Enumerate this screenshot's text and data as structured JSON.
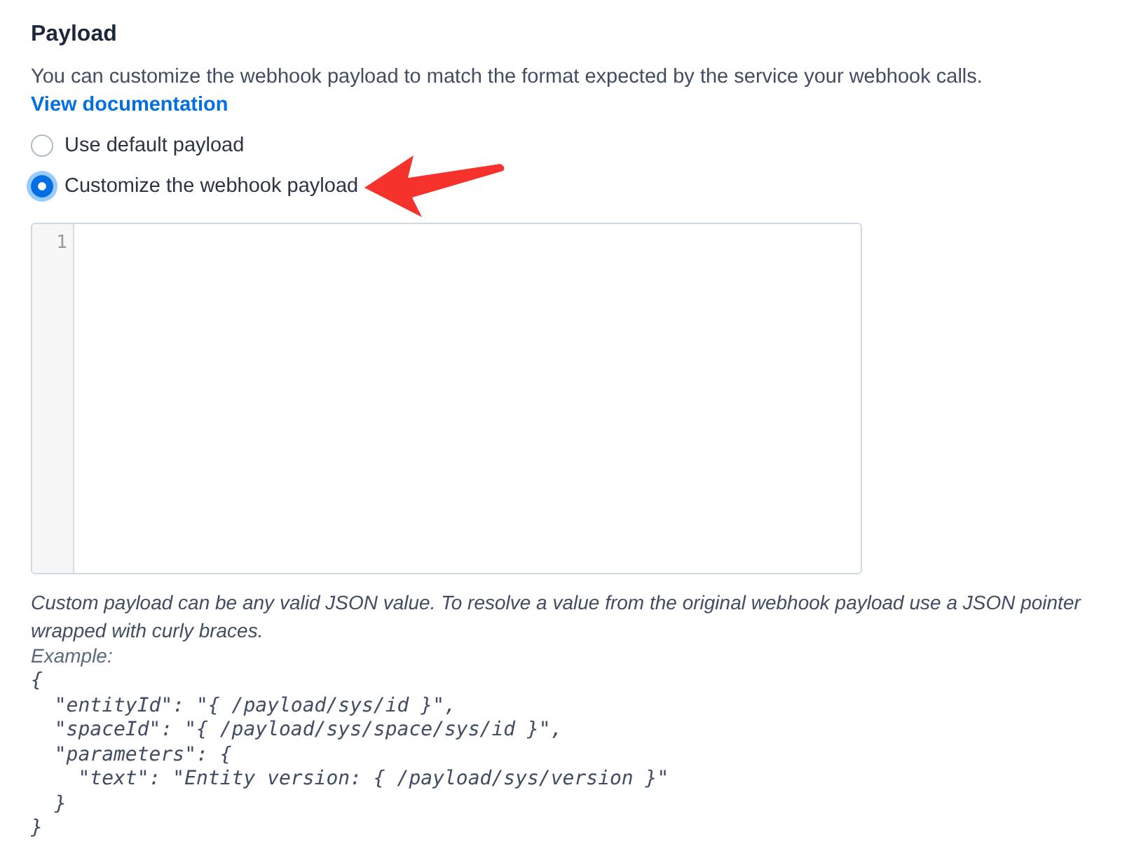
{
  "section": {
    "title": "Payload",
    "description": "You can customize the webhook payload to match the format expected by the service your webhook calls.",
    "link": "View documentation"
  },
  "options": [
    {
      "label": "Use default payload",
      "selected": false
    },
    {
      "label": "Customize the webhook payload",
      "selected": true
    }
  ],
  "editor": {
    "line_numbers": [
      "1"
    ]
  },
  "help": {
    "text": "Custom payload can be any valid JSON value. To resolve a value from the original webhook payload use a JSON pointer wrapped with curly braces.",
    "example_label": "Example:",
    "example_code": [
      "{",
      "  \"entityId\": \"{ /payload/sys/id }\",",
      "  \"spaceId\": \"{ /payload/sys/space/sys/id }\",",
      "  \"parameters\": {",
      "    \"text\": \"Entity version: { /payload/sys/version }\"",
      "  }",
      "}"
    ]
  }
}
